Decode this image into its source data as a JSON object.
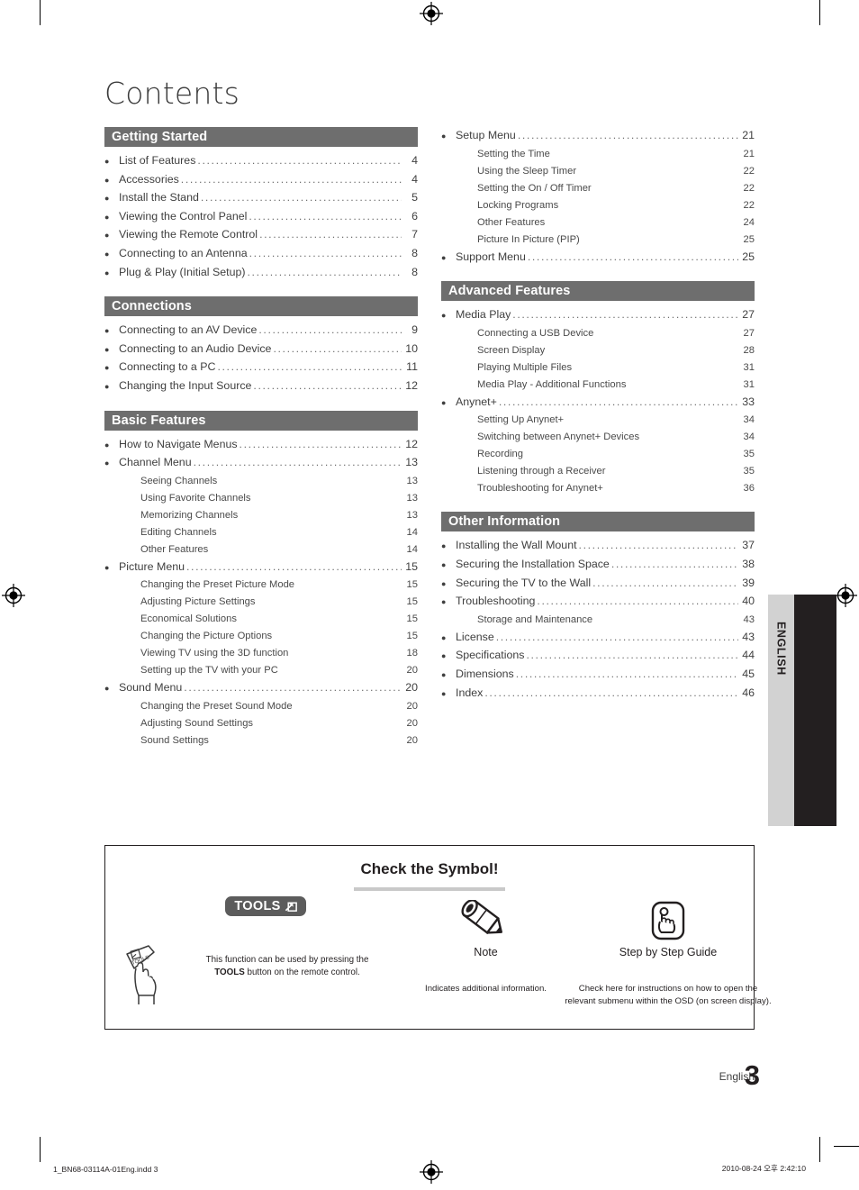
{
  "page": {
    "title": "Contents",
    "language_tab": "ENGLISH",
    "footer_language": "English",
    "page_number": "3",
    "print_slug_left": "1_BN68-03114A-01Eng.indd   3",
    "print_slug_right": "2010-08-24   오후 2:42:10"
  },
  "colors": {
    "section_bar": "#6e6e6e",
    "tab_gray": "#d2d2d2",
    "tab_black": "#231f20",
    "tools_badge": "#5c5c5c",
    "title_underline": "#c9c9c9"
  },
  "toc": {
    "left_column": [
      {
        "heading": "Getting Started",
        "entries": [
          {
            "level": 1,
            "label": "List of Features",
            "page": "4"
          },
          {
            "level": 1,
            "label": "Accessories",
            "page": "4"
          },
          {
            "level": 1,
            "label": "Install the Stand",
            "page": "5"
          },
          {
            "level": 1,
            "label": "Viewing the Control Panel",
            "page": "6"
          },
          {
            "level": 1,
            "label": "Viewing the Remote Control",
            "page": "7"
          },
          {
            "level": 1,
            "label": "Connecting to an Antenna",
            "page": "8"
          },
          {
            "level": 1,
            "label": "Plug & Play (Initial Setup)",
            "page": "8"
          }
        ]
      },
      {
        "heading": "Connections",
        "entries": [
          {
            "level": 1,
            "label": "Connecting to an AV Device",
            "page": "9"
          },
          {
            "level": 1,
            "label": "Connecting to an Audio Device",
            "page": "10"
          },
          {
            "level": 1,
            "label": "Connecting to a PC",
            "page": "11"
          },
          {
            "level": 1,
            "label": "Changing the Input Source",
            "page": "12"
          }
        ]
      },
      {
        "heading": "Basic Features",
        "entries": [
          {
            "level": 1,
            "label": "How to Navigate Menus",
            "page": "12"
          },
          {
            "level": 1,
            "label": "Channel Menu",
            "page": "13"
          },
          {
            "level": 2,
            "label": "Seeing Channels",
            "page": "13"
          },
          {
            "level": 2,
            "label": "Using Favorite Channels",
            "page": "13"
          },
          {
            "level": 2,
            "label": "Memorizing Channels",
            "page": "13"
          },
          {
            "level": 2,
            "label": "Editing Channels",
            "page": "14"
          },
          {
            "level": 2,
            "label": "Other Features",
            "page": "14"
          },
          {
            "level": 1,
            "label": "Picture Menu",
            "page": "15"
          },
          {
            "level": 2,
            "label": "Changing the Preset Picture Mode",
            "page": "15"
          },
          {
            "level": 2,
            "label": "Adjusting Picture Settings",
            "page": "15"
          },
          {
            "level": 2,
            "label": "Economical Solutions",
            "page": "15"
          },
          {
            "level": 2,
            "label": "Changing the Picture Options",
            "page": "15"
          },
          {
            "level": 2,
            "label": "Viewing TV using the 3D function",
            "page": "18"
          },
          {
            "level": 2,
            "label": "Setting up the TV with your PC",
            "page": "20"
          },
          {
            "level": 1,
            "label": "Sound Menu",
            "page": "20"
          },
          {
            "level": 2,
            "label": "Changing the Preset Sound Mode",
            "page": "20"
          },
          {
            "level": 2,
            "label": "Adjusting Sound Settings",
            "page": "20"
          },
          {
            "level": 2,
            "label": "Sound Settings",
            "page": "20"
          }
        ]
      }
    ],
    "right_column": [
      {
        "heading": "",
        "entries": [
          {
            "level": 1,
            "label": "Setup Menu",
            "page": "21"
          },
          {
            "level": 2,
            "label": "Setting the Time",
            "page": "21"
          },
          {
            "level": 2,
            "label": "Using the Sleep Timer",
            "page": "22"
          },
          {
            "level": 2,
            "label": "Setting the On / Off Timer",
            "page": "22"
          },
          {
            "level": 2,
            "label": "Locking Programs",
            "page": "22"
          },
          {
            "level": 2,
            "label": "Other Features",
            "page": "24"
          },
          {
            "level": 2,
            "label": "Picture In Picture (PIP)",
            "page": "25"
          },
          {
            "level": 1,
            "label": "Support Menu",
            "page": "25"
          }
        ]
      },
      {
        "heading": "Advanced Features",
        "entries": [
          {
            "level": 1,
            "label": "Media Play",
            "page": "27"
          },
          {
            "level": 2,
            "label": "Connecting a USB Device",
            "page": "27"
          },
          {
            "level": 2,
            "label": "Screen Display",
            "page": "28"
          },
          {
            "level": 2,
            "label": "Playing Multiple Files",
            "page": "31"
          },
          {
            "level": 2,
            "label": "Media Play - Additional Functions",
            "page": "31"
          },
          {
            "level": 1,
            "label": "Anynet+",
            "page": "33"
          },
          {
            "level": 2,
            "label": "Setting Up Anynet+",
            "page": "34"
          },
          {
            "level": 2,
            "label": "Switching between Anynet+ Devices",
            "page": "34"
          },
          {
            "level": 2,
            "label": "Recording",
            "page": "35"
          },
          {
            "level": 2,
            "label": "Listening through a Receiver",
            "page": "35"
          },
          {
            "level": 2,
            "label": "Troubleshooting for Anynet+",
            "page": "36"
          }
        ]
      },
      {
        "heading": "Other Information",
        "entries": [
          {
            "level": 1,
            "label": "Installing the Wall Mount",
            "page": "37"
          },
          {
            "level": 1,
            "label": "Securing the Installation Space",
            "page": "38"
          },
          {
            "level": 1,
            "label": "Securing the TV to the Wall",
            "page": "39"
          },
          {
            "level": 1,
            "label": "Troubleshooting",
            "page": "40"
          },
          {
            "level": 2,
            "label": "Storage and Maintenance",
            "page": "43"
          },
          {
            "level": 1,
            "label": "License",
            "page": "43"
          },
          {
            "level": 1,
            "label": "Specifications",
            "page": "44"
          },
          {
            "level": 1,
            "label": "Dimensions",
            "page": "45"
          },
          {
            "level": 1,
            "label": "Index",
            "page": "46"
          }
        ]
      }
    ]
  },
  "symbol_box": {
    "title": "Check the Symbol!",
    "items": [
      {
        "icon": "tools-badge",
        "badge_label": "TOOLS",
        "caption": "",
        "description": "This function can be used by pressing the TOOLS button on the remote control.",
        "description_part1": "This function can be used by pressing the",
        "description_bold": "TOOLS",
        "description_part2": " button on the remote control."
      },
      {
        "icon": "pencil-icon",
        "caption": "Note",
        "description": "Indicates additional information."
      },
      {
        "icon": "pointing-hand-icon",
        "caption": "Step by Step Guide",
        "description": "Check here for instructions on how to open the relevant submenu within the OSD (on screen display)."
      }
    ]
  }
}
